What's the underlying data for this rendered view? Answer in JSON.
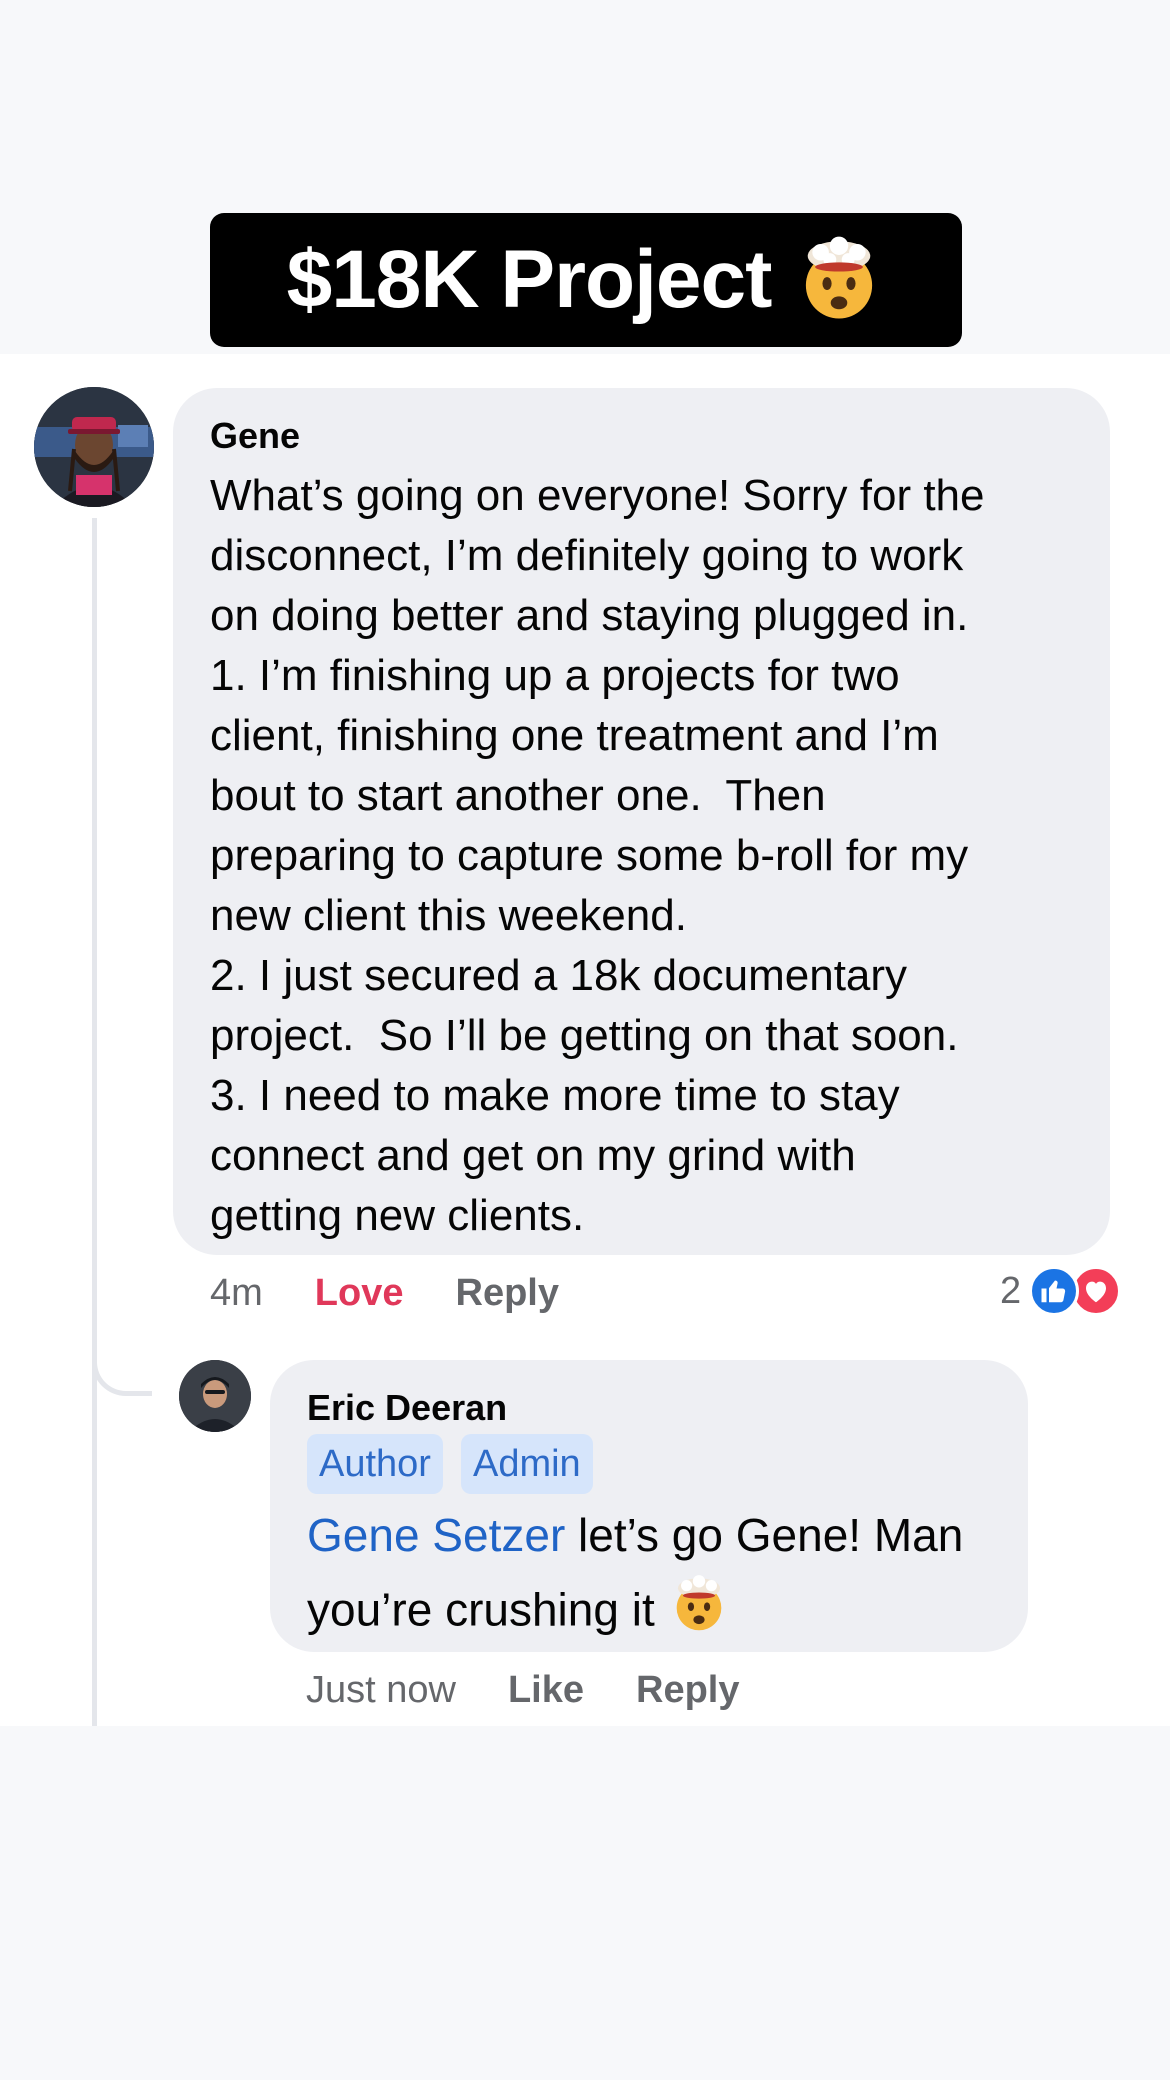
{
  "banner": {
    "title": "$18K Project",
    "emoji_icon": "exploding-head-emoji"
  },
  "comments": [
    {
      "author": "Gene",
      "text": "What’s going on everyone! Sorry for the\ndisconnect, I’m definitely going to work\non doing better and staying plugged in.\n1. I’m finishing up a projects for two\nclient, finishing one treatment and I’m\nbout to start another one.  Then\npreparing to capture some b-roll for my\nnew client this weekend.\n2. I just secured a 18k documentary\nproject.  So I’ll be getting on that soon.\n3. I need to make more time to stay\nconnect and get on my grind with\ngetting new clients.",
      "time": "4m",
      "reaction_label": "Love",
      "reply_label": "Reply",
      "reaction_count": "2",
      "reaction_icons": [
        "like-reaction-icon",
        "love-reaction-icon"
      ]
    },
    {
      "author": "Eric Deeran",
      "badges": [
        "Author",
        "Admin"
      ],
      "mention": "Gene Setzer",
      "text_line1": " let’s go Gene! Man",
      "text_line2": "you’re crushing it",
      "emoji_icon": "exploding-head-emoji",
      "time": "Just now",
      "like_label": "Like",
      "reply_label": "Reply"
    }
  ],
  "colors": {
    "background": "#f7f8fa",
    "bubble": "#eeeff3",
    "mention": "#1f63c6",
    "love": "#e0385a",
    "badge_bg": "#d6e5fb",
    "badge_text": "#2d6ac7",
    "like_reaction": "#1b74e4",
    "love_reaction": "#f33e58"
  }
}
